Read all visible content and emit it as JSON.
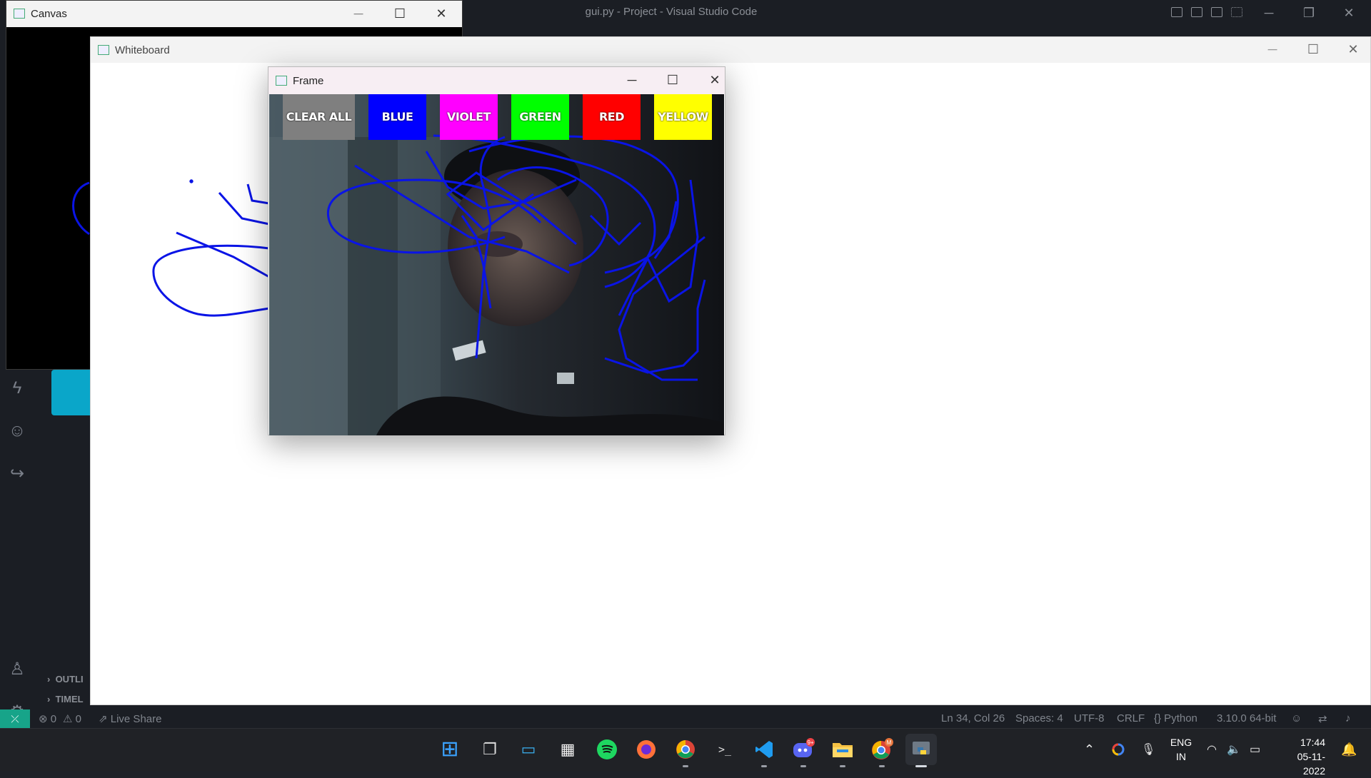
{
  "vscode": {
    "title": "gui.py - Project - Visual Studio Code",
    "minimize": "─",
    "restore": "❐",
    "close": "✕",
    "sidebar_sections": [
      "OUTLI",
      "TIMEL"
    ],
    "status": {
      "remote": "⤫",
      "errors": "⊗ 0",
      "warnings": "⚠ 0",
      "live_share": "Live Share",
      "position": "Ln 34, Col 26",
      "spaces": "Spaces: 4",
      "encoding": "UTF-8",
      "eol": "CRLF",
      "language": "{} Python",
      "interpreter": "3.10.0 64-bit"
    }
  },
  "canvas_window": {
    "title": "Canvas",
    "minimize": "─",
    "maximize": "☐",
    "close": "✕"
  },
  "whiteboard_window": {
    "title": "Whiteboard",
    "minimize": "─",
    "maximize": "☐",
    "close": "✕"
  },
  "frame_window": {
    "title": "Frame",
    "minimize": "─",
    "maximize": "☐",
    "close": "✕",
    "buttons": [
      {
        "label": "CLEAR ALL",
        "color": "#7f7f7f"
      },
      {
        "label": "BLUE",
        "color": "#0000ff"
      },
      {
        "label": "VIOLET",
        "color": "#ff00ff"
      },
      {
        "label": "GREEN",
        "color": "#00ff00"
      },
      {
        "label": "RED",
        "color": "#ff0000"
      },
      {
        "label": "YELLOW",
        "color": "#ffff00"
      }
    ],
    "stroke_color": "#0a14e6"
  },
  "taskbar": {
    "apps": [
      {
        "name": "start",
        "glyph": "⊞"
      },
      {
        "name": "task-view",
        "glyph": "❐"
      },
      {
        "name": "desktop",
        "glyph": "▭"
      },
      {
        "name": "store",
        "glyph": "▦"
      },
      {
        "name": "spotify",
        "glyph": "♫"
      },
      {
        "name": "firefox",
        "glyph": "◉"
      },
      {
        "name": "chrome-profile-1",
        "glyph": "◍"
      },
      {
        "name": "terminal",
        "glyph": ">_"
      },
      {
        "name": "vscode",
        "glyph": "⋈"
      },
      {
        "name": "discord",
        "glyph": "☻",
        "badge": "9+"
      },
      {
        "name": "file-explorer",
        "glyph": "▬"
      },
      {
        "name": "chrome-profile-2",
        "glyph": "◍",
        "badge": "M"
      },
      {
        "name": "python",
        "glyph": "⟁"
      }
    ],
    "tray": {
      "lang_top": "ENG",
      "lang_bottom": "IN",
      "time": "17:44",
      "date": "05-11-2022"
    }
  }
}
